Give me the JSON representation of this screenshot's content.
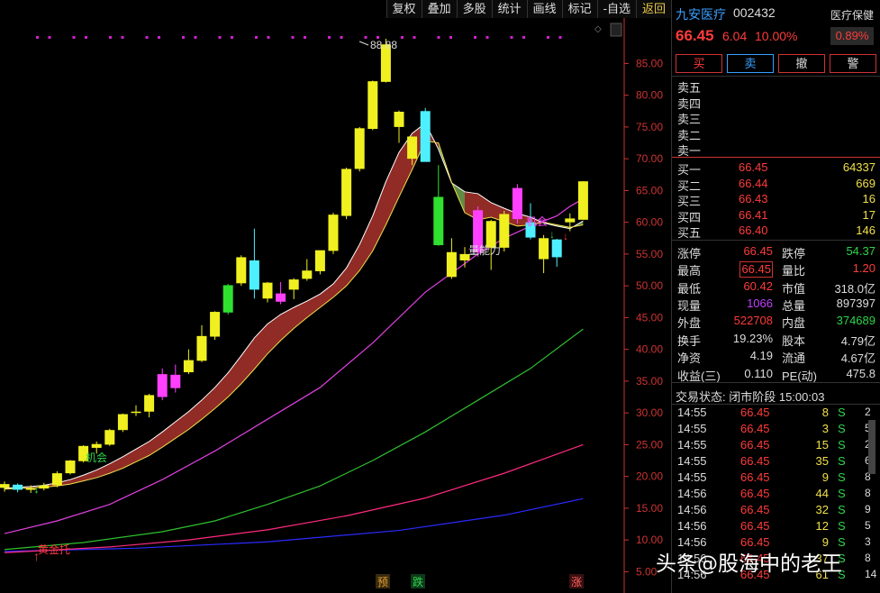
{
  "toolbar": [
    "复权",
    "叠加",
    "多股",
    "统计",
    "画线",
    "标记",
    "-自选",
    "返回"
  ],
  "chart_data": {
    "type": "candlestick",
    "ylim": [
      5,
      90
    ],
    "yticks": [
      "85.00",
      "80.00",
      "75.00",
      "70.00",
      "65.00",
      "60.00",
      "55.00",
      "50.00",
      "45.00",
      "40.00",
      "35.00",
      "30.00",
      "25.00",
      "20.00",
      "15.00",
      "10.00",
      "5.00"
    ],
    "ytick_values": [
      85,
      80,
      75,
      70,
      65,
      60,
      55,
      50,
      45,
      40,
      35,
      30,
      25,
      20,
      15,
      10,
      5
    ],
    "candles": [
      [
        18.2,
        19.2,
        17.6,
        18.8
      ],
      [
        18.7,
        18.9,
        17.5,
        17.9
      ],
      [
        18.0,
        18.6,
        17.4,
        18.1
      ],
      [
        18.1,
        19.0,
        17.8,
        18.6
      ],
      [
        18.6,
        20.8,
        18.3,
        20.5
      ],
      [
        20.5,
        22.6,
        20.3,
        22.5
      ],
      [
        22.4,
        24.9,
        22.2,
        24.8
      ],
      [
        24.5,
        25.5,
        23.6,
        25.1
      ],
      [
        25.0,
        27.5,
        24.8,
        27.3
      ],
      [
        27.3,
        29.9,
        27.0,
        29.8
      ],
      [
        30.0,
        31.2,
        29.5,
        30.2
      ],
      [
        30.2,
        33.0,
        29.3,
        32.8
      ],
      [
        32.5,
        37.0,
        32.0,
        36.1
      ],
      [
        36.0,
        37.6,
        33.2,
        33.9
      ],
      [
        36.4,
        40.0,
        36.1,
        38.3
      ],
      [
        38.2,
        43.8,
        38.0,
        42.1
      ],
      [
        42.0,
        46.0,
        41.5,
        45.9
      ],
      [
        45.8,
        50.3,
        45.5,
        50.1
      ],
      [
        50.4,
        54.8,
        50.0,
        54.5
      ],
      [
        54.0,
        59.0,
        48.0,
        49.4
      ],
      [
        48.0,
        50.6,
        47.4,
        50.5
      ],
      [
        48.8,
        50.6,
        47.1,
        47.5
      ],
      [
        49.4,
        51.2,
        47.9,
        51.0
      ],
      [
        51.1,
        54.2,
        50.8,
        52.4
      ],
      [
        52.3,
        54.5,
        51.8,
        55.6
      ],
      [
        55.5,
        61.5,
        55.0,
        61.2
      ],
      [
        61.0,
        68.6,
        60.5,
        68.4
      ],
      [
        68.4,
        75.0,
        68.0,
        74.8
      ],
      [
        74.7,
        82.3,
        74.5,
        82.2
      ],
      [
        82.1,
        88.88,
        82.0,
        88.0
      ],
      [
        75.0,
        77.6,
        72.5,
        77.4
      ],
      [
        70.0,
        73.0,
        69.0,
        73.5
      ],
      [
        77.5,
        78.0,
        69.6,
        69.5
      ],
      [
        64.0,
        69.0,
        56.3,
        56.4
      ],
      [
        51.4,
        57.5,
        51.1,
        55.3
      ],
      [
        54.0,
        56.1,
        52.9,
        55.0
      ],
      [
        55.3,
        62.5,
        54.6,
        61.9
      ],
      [
        56.0,
        60.4,
        52.5,
        60.2
      ],
      [
        56.0,
        61.8,
        55.4,
        61.3
      ],
      [
        60.5,
        66.0,
        59.8,
        65.4
      ],
      [
        60.0,
        63.0,
        57.3,
        57.6
      ],
      [
        54.2,
        58.0,
        52.0,
        57.5
      ],
      [
        57.3,
        57.4,
        53.0,
        54.5
      ],
      [
        60.0,
        61.4,
        58.6,
        60.6
      ],
      [
        60.4,
        66.45,
        60.42,
        66.45
      ]
    ],
    "ma_white": [
      18.1,
      18.3,
      18.4,
      18.6,
      19.0,
      19.5,
      20.2,
      21.0,
      22.0,
      23.1,
      24.3,
      25.5,
      27.0,
      28.6,
      30.2,
      32.0,
      34.0,
      36.3,
      39.0,
      41.8,
      44.0,
      45.5,
      46.6,
      47.6,
      48.7,
      50.3,
      52.8,
      56.5,
      61.0,
      66.4,
      71.0,
      74.0,
      75.6,
      71.5,
      66.2,
      64.8,
      64.5,
      63.1,
      62.2,
      61.4,
      60.8,
      59.9,
      59.4,
      59.0,
      60.2
    ],
    "ma_yellow": [
      18.0,
      18.1,
      18.2,
      18.3,
      18.5,
      18.8,
      19.3,
      19.8,
      20.5,
      21.3,
      22.3,
      23.3,
      24.6,
      26.0,
      27.4,
      29.0,
      30.7,
      32.5,
      34.6,
      36.9,
      39.3,
      41.4,
      43.3,
      45.0,
      46.6,
      48.2,
      50.0,
      52.4,
      55.5,
      59.6,
      64.0,
      68.3,
      72.8,
      72.5,
      66.3,
      61.5,
      60.4,
      60.8,
      60.1,
      59.4,
      59.6,
      60.0,
      59.6,
      59.2,
      59.6
    ],
    "ma_magenta": [
      [
        0,
        11.0
      ],
      [
        4,
        13.0
      ],
      [
        8,
        15.6
      ],
      [
        12,
        19.5
      ],
      [
        16,
        24.0
      ],
      [
        20,
        29.0
      ],
      [
        24,
        34.0
      ],
      [
        28,
        41.0
      ],
      [
        32,
        49.0
      ],
      [
        36,
        55.0
      ],
      [
        38,
        57.5
      ],
      [
        40,
        59.4
      ],
      [
        42,
        61.0
      ],
      [
        43,
        62.5
      ],
      [
        44,
        63.7
      ]
    ],
    "ma_green": [
      [
        0,
        8.5
      ],
      [
        6,
        9.6
      ],
      [
        12,
        11.3
      ],
      [
        16,
        13.0
      ],
      [
        20,
        15.6
      ],
      [
        24,
        18.5
      ],
      [
        28,
        22.5
      ],
      [
        32,
        27.0
      ],
      [
        36,
        32.0
      ],
      [
        40,
        37.0
      ],
      [
        44,
        43.2
      ]
    ],
    "ma_pink": [
      [
        0,
        8.0
      ],
      [
        8,
        8.9
      ],
      [
        14,
        10.0
      ],
      [
        20,
        11.6
      ],
      [
        26,
        13.8
      ],
      [
        32,
        16.6
      ],
      [
        38,
        20.5
      ],
      [
        44,
        25.0
      ]
    ],
    "ma_blue": [
      [
        0,
        8.2
      ],
      [
        10,
        8.7
      ],
      [
        20,
        9.7
      ],
      [
        30,
        11.5
      ],
      [
        38,
        13.9
      ],
      [
        44,
        16.5
      ]
    ],
    "annotations": {
      "peak": "88.88",
      "signal_opportunity": "机会",
      "signal_golden": "黄金托",
      "signal_main_force": "量能力",
      "signal_chance2": "机会",
      "bottom_pre": "预",
      "bottom_fall": "跌",
      "bottom_rise": "涨"
    }
  },
  "stock": {
    "name": "九安医疗",
    "code": "002432",
    "price": "66.45",
    "change": "6.04",
    "change_pct": "10.00%",
    "sector": "医疗保健",
    "sector_pct": "0.89%"
  },
  "buttons": {
    "buy": "买",
    "sell": "卖",
    "cancel": "撤",
    "alert": "警"
  },
  "asks": [
    "卖五",
    "卖四",
    "卖三",
    "卖二",
    "卖一"
  ],
  "bids": [
    {
      "label": "买一",
      "price": "66.45",
      "vol": "64337"
    },
    {
      "label": "买二",
      "price": "66.44",
      "vol": "669"
    },
    {
      "label": "买三",
      "price": "66.43",
      "vol": "16"
    },
    {
      "label": "买四",
      "price": "66.41",
      "vol": "17"
    },
    {
      "label": "买五",
      "price": "66.40",
      "vol": "146"
    }
  ],
  "stats": {
    "limit_up_label": "涨停",
    "limit_up": "66.45",
    "limit_down_label": "跌停",
    "limit_down": "54.37",
    "high_label": "最高",
    "high": "66.45",
    "vol_ratio_label": "量比",
    "vol_ratio": "1.20",
    "low_label": "最低",
    "low": "60.42",
    "mcap_label": "市值",
    "mcap": "318.0亿",
    "cur_vol_label": "现量",
    "cur_vol": "1066",
    "total_vol_label": "总量",
    "total_vol": "897397",
    "outer_label": "外盘",
    "outer": "522708",
    "inner_label": "内盘",
    "inner": "374689",
    "turnover_label": "换手",
    "turnover": "19.23%",
    "capital_label": "股本",
    "capital": "4.79亿",
    "nav_label": "净资",
    "nav": "4.19",
    "float_label": "流通",
    "float": "4.67亿",
    "eps_label": "收益(三)",
    "eps": "0.110",
    "pe_label": "PE(动)",
    "pe": "475.8"
  },
  "trade_status": "交易状态: 闭市阶段 15:00:03",
  "ticks": [
    {
      "t": "14:55",
      "p": "66.45",
      "v": "8",
      "s": "S"
    },
    {
      "t": "14:55",
      "p": "66.45",
      "v": "3",
      "s": "S"
    },
    {
      "t": "14:55",
      "p": "66.45",
      "v": "15",
      "s": "S"
    },
    {
      "t": "14:55",
      "p": "66.45",
      "v": "35",
      "s": "S"
    },
    {
      "t": "14:55",
      "p": "66.45",
      "v": "9",
      "s": "S"
    },
    {
      "t": "14:56",
      "p": "66.45",
      "v": "44",
      "s": "S"
    },
    {
      "t": "14:56",
      "p": "66.45",
      "v": "32",
      "s": "S"
    },
    {
      "t": "14:56",
      "p": "66.45",
      "v": "12",
      "s": "S"
    },
    {
      "t": "14:56",
      "p": "66.45",
      "v": "9",
      "s": "S"
    },
    {
      "t": "14:56",
      "p": "66.45",
      "v": "37",
      "s": "S"
    },
    {
      "t": "14:56",
      "p": "66.45",
      "v": "61",
      "s": "S"
    }
  ],
  "ticks_tail": [
    "2",
    "5",
    "2",
    "6",
    "8",
    "8",
    "9",
    "5",
    "3",
    "8",
    "14"
  ],
  "watermark": "头条@股海中的老王"
}
